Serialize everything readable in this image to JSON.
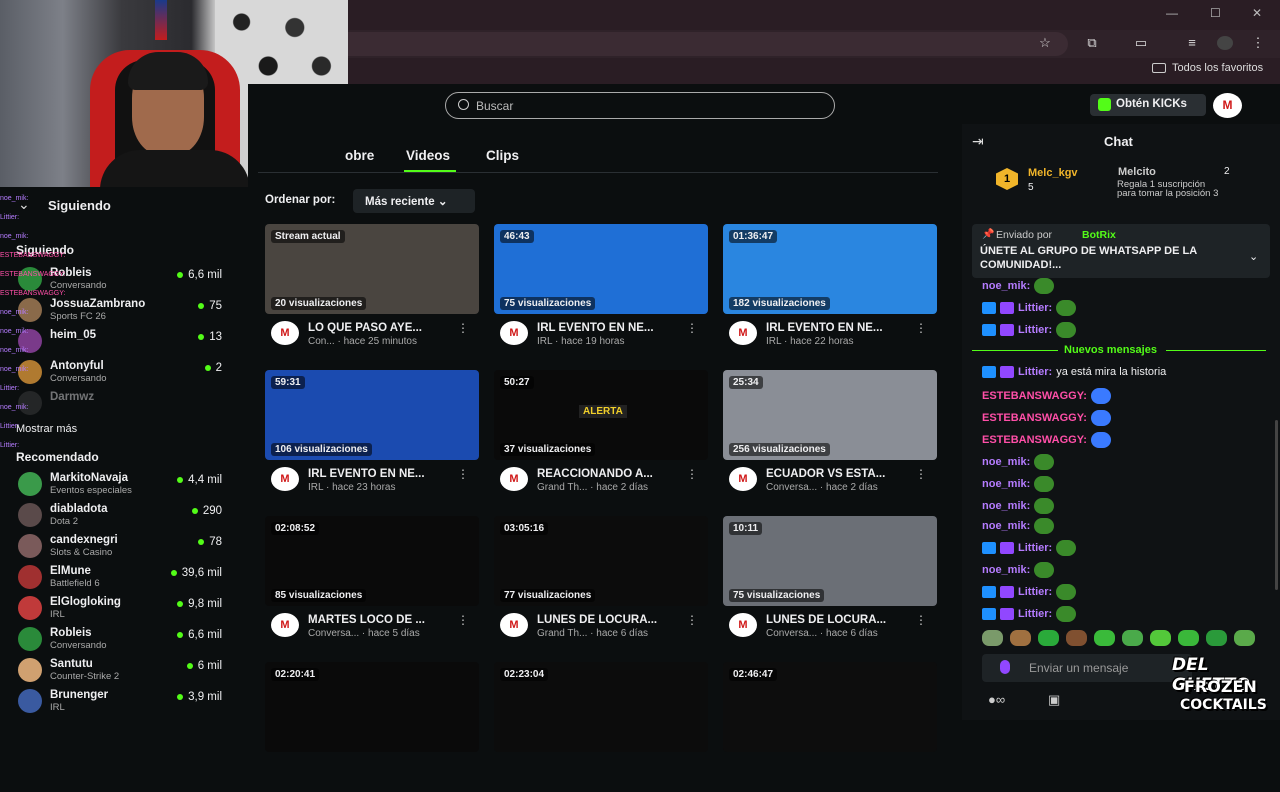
{
  "browser": {
    "bookmarks_label": "Todos los favoritos",
    "win_min": "—",
    "win_max": "☐",
    "win_close": "✕"
  },
  "header": {
    "search_placeholder": "Buscar",
    "kicks_label": "Obtén KICKs",
    "user_initial": "M"
  },
  "profile_tabs": [
    {
      "label": "obre"
    },
    {
      "label": "Videos"
    },
    {
      "label": "Clips"
    }
  ],
  "sort": {
    "label": "Ordenar por:",
    "value": "Más reciente"
  },
  "videos": [
    {
      "badge": "Stream actual",
      "views": "20 visualizaciones",
      "title": "LO QUE PASO AYE...",
      "cat": "Con...",
      "time": "hace 25 minutos",
      "thumb": "#4a4540"
    },
    {
      "badge": "46:43",
      "views": "75 visualizaciones",
      "title": "IRL EVENTO EN NE...",
      "cat": "IRL",
      "time": "hace 19 horas",
      "thumb": "#1f6fd6"
    },
    {
      "badge": "01:36:47",
      "views": "182 visualizaciones",
      "title": "IRL EVENTO EN NE...",
      "cat": "IRL",
      "time": "hace 22 horas",
      "thumb": "#2a86e0"
    },
    {
      "badge": "59:31",
      "views": "106 visualizaciones",
      "title": "IRL EVENTO EN NE...",
      "cat": "IRL",
      "time": "hace 23 horas",
      "thumb": "#1b4bb0"
    },
    {
      "badge": "50:27",
      "views": "37 visualizaciones",
      "title": "REACCIONANDO A...",
      "cat": "Grand Th...",
      "time": "hace 2 días",
      "thumb": "#0a0a0a",
      "thumb_text": "ALERTA"
    },
    {
      "badge": "25:34",
      "views": "256 visualizaciones",
      "title": "ECUADOR VS ESTA...",
      "cat": "Conversa...",
      "time": "hace 2 días",
      "thumb": "#8a8e96"
    },
    {
      "badge": "02:08:52",
      "views": "85 visualizaciones",
      "title": "MARTES LOCO DE ...",
      "cat": "Conversa...",
      "time": "hace 5 días",
      "thumb": "#0a0a0a"
    },
    {
      "badge": "03:05:16",
      "views": "77 visualizaciones",
      "title": "LUNES DE LOCURA...",
      "cat": "Grand Th...",
      "time": "hace 6 días",
      "thumb": "#0c0c0c"
    },
    {
      "badge": "10:11",
      "views": "75 visualizaciones",
      "title": "LUNES DE LOCURA...",
      "cat": "Conversa...",
      "time": "hace 6 días",
      "thumb": "#6b6f76"
    },
    {
      "badge": "02:20:41",
      "thumb": "#0a0a0a"
    },
    {
      "badge": "02:23:04",
      "thumb": "#0c0c0c"
    },
    {
      "badge": "02:46:47",
      "thumb": "#0d0d0d"
    }
  ],
  "sidebar": {
    "header": "Siguiendo",
    "following_title": "Siguiendo",
    "following": [
      {
        "name": "Robleis",
        "cat": "Conversando",
        "views": "6,6 mil",
        "color": "#2a8a3a"
      },
      {
        "name": "JossuaZambrano",
        "cat": "Sports FC 26",
        "views": "75",
        "color": "#8a6a4a"
      },
      {
        "name": "heim_05",
        "cat": "",
        "views": "13",
        "color": "#7a3a8a"
      },
      {
        "name": "Antonyful",
        "cat": "Conversando",
        "views": "2",
        "color": "#b07a30"
      },
      {
        "name": "Darmwz",
        "cat": "",
        "views": "",
        "color": "#444"
      }
    ],
    "show_more": "Mostrar más",
    "recommended_title": "Recomendado",
    "recommended": [
      {
        "name": "MarkitoNavaja",
        "cat": "Eventos especiales",
        "views": "4,4 mil",
        "color": "#3a9a4a"
      },
      {
        "name": "diabladota",
        "cat": "Dota 2",
        "views": "290",
        "color": "#5a4a4a"
      },
      {
        "name": "candexnegri",
        "cat": "Slots & Casino",
        "views": "78",
        "color": "#7a5a5a"
      },
      {
        "name": "ElMune",
        "cat": "Battlefield 6",
        "views": "39,6 mil",
        "color": "#a03030"
      },
      {
        "name": "ElGlogloking",
        "cat": "IRL",
        "views": "9,8 mil",
        "color": "#c03a3a"
      },
      {
        "name": "Robleis",
        "cat": "Conversando",
        "views": "6,6 mil",
        "color": "#2a8a3a"
      },
      {
        "name": "Santutu",
        "cat": "Counter-Strike 2",
        "views": "6 mil",
        "color": "#d0a070"
      },
      {
        "name": "Brunenger",
        "cat": "IRL",
        "views": "3,9 mil",
        "color": "#3a5aa0"
      }
    ],
    "overlay_lines": [
      "noe_mik:",
      "Littier:",
      "noe_mik:",
      "ESTEBANSWAGGY:",
      "ESTEBANSWAGGY:",
      "ESTEBANSWAGGY:",
      "noe_mik:",
      "noe_mik:",
      "noe_mik:",
      "noe_mik:",
      "Littier:",
      "noe_mik:",
      "Littier:",
      "Littier:"
    ]
  },
  "chat": {
    "title": "Chat",
    "leader1_name": "Melc_kgv",
    "leader1_rank": "1",
    "leader1_count": "5",
    "leader2_name": "Melcito",
    "leader2_count": "2",
    "leader2_sub": "Regala 1 suscripción",
    "leader2_sub2": "para tomar la posición 3",
    "pinned_from": "Enviado por",
    "pinned_user": "BotRix",
    "pinned_text": "ÚNETE AL GRUPO DE WHATSAPP DE LA COMUNIDAD!...",
    "new_messages": "Nuevos mensajes",
    "messages": [
      {
        "user": "noe_mik:",
        "color": "#b57cff",
        "text": ""
      },
      {
        "user": "Littier:",
        "color": "#b57cff",
        "text": ""
      },
      {
        "user": "Littier:",
        "color": "#b57cff",
        "text": ""
      },
      {
        "user": "Littier:",
        "color": "#b57cff",
        "text": "ya está mira la historia"
      },
      {
        "user": "ESTEBANSWAGGY:",
        "color": "#ff4fa8",
        "text": ""
      },
      {
        "user": "ESTEBANSWAGGY:",
        "color": "#ff4fa8",
        "text": ""
      },
      {
        "user": "ESTEBANSWAGGY:",
        "color": "#ff4fa8",
        "text": ""
      },
      {
        "user": "noe_mik:",
        "color": "#b57cff",
        "text": ""
      },
      {
        "user": "noe_mik:",
        "color": "#b57cff",
        "text": ""
      },
      {
        "user": "noe_mik:",
        "color": "#b57cff",
        "text": ""
      },
      {
        "user": "noe_mik:",
        "color": "#b57cff",
        "text": ""
      },
      {
        "user": "Littier:",
        "color": "#b57cff",
        "text": ""
      },
      {
        "user": "noe_mik:",
        "color": "#b57cff",
        "text": ""
      },
      {
        "user": "Littier:",
        "color": "#b57cff",
        "text": ""
      },
      {
        "user": "Littier:",
        "color": "#b57cff",
        "text": ""
      }
    ],
    "input_placeholder": "Enviar un mensaje"
  },
  "logo": {
    "line1": "DEL GHETTO",
    "line2": "FROZEN",
    "line3": "COCKTAILS"
  },
  "colors": {
    "accent": "#53fc18"
  }
}
